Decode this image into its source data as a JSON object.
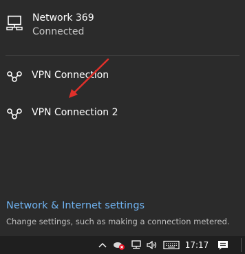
{
  "network": {
    "name": "Network 369",
    "status": "Connected",
    "icon": "wired-network-icon"
  },
  "vpn_connections": [
    {
      "label": "VPN Connection",
      "icon": "vpn-icon"
    },
    {
      "label": "VPN Connection 2",
      "icon": "vpn-icon"
    }
  ],
  "settings": {
    "link_text": "Network & Internet settings",
    "description": "Change settings, such as making a connection metered."
  },
  "taskbar": {
    "time": "17:17",
    "icons": [
      "chevron-up-icon",
      "cloud-error-icon",
      "network-icon",
      "volume-icon",
      "keyboard-icon",
      "notifications-icon"
    ]
  },
  "colors": {
    "flyout_bg": "#2b2b2b",
    "taskbar_bg": "#1f1f1f",
    "link": "#6fb2f0",
    "annotation_arrow": "#e0302a"
  }
}
